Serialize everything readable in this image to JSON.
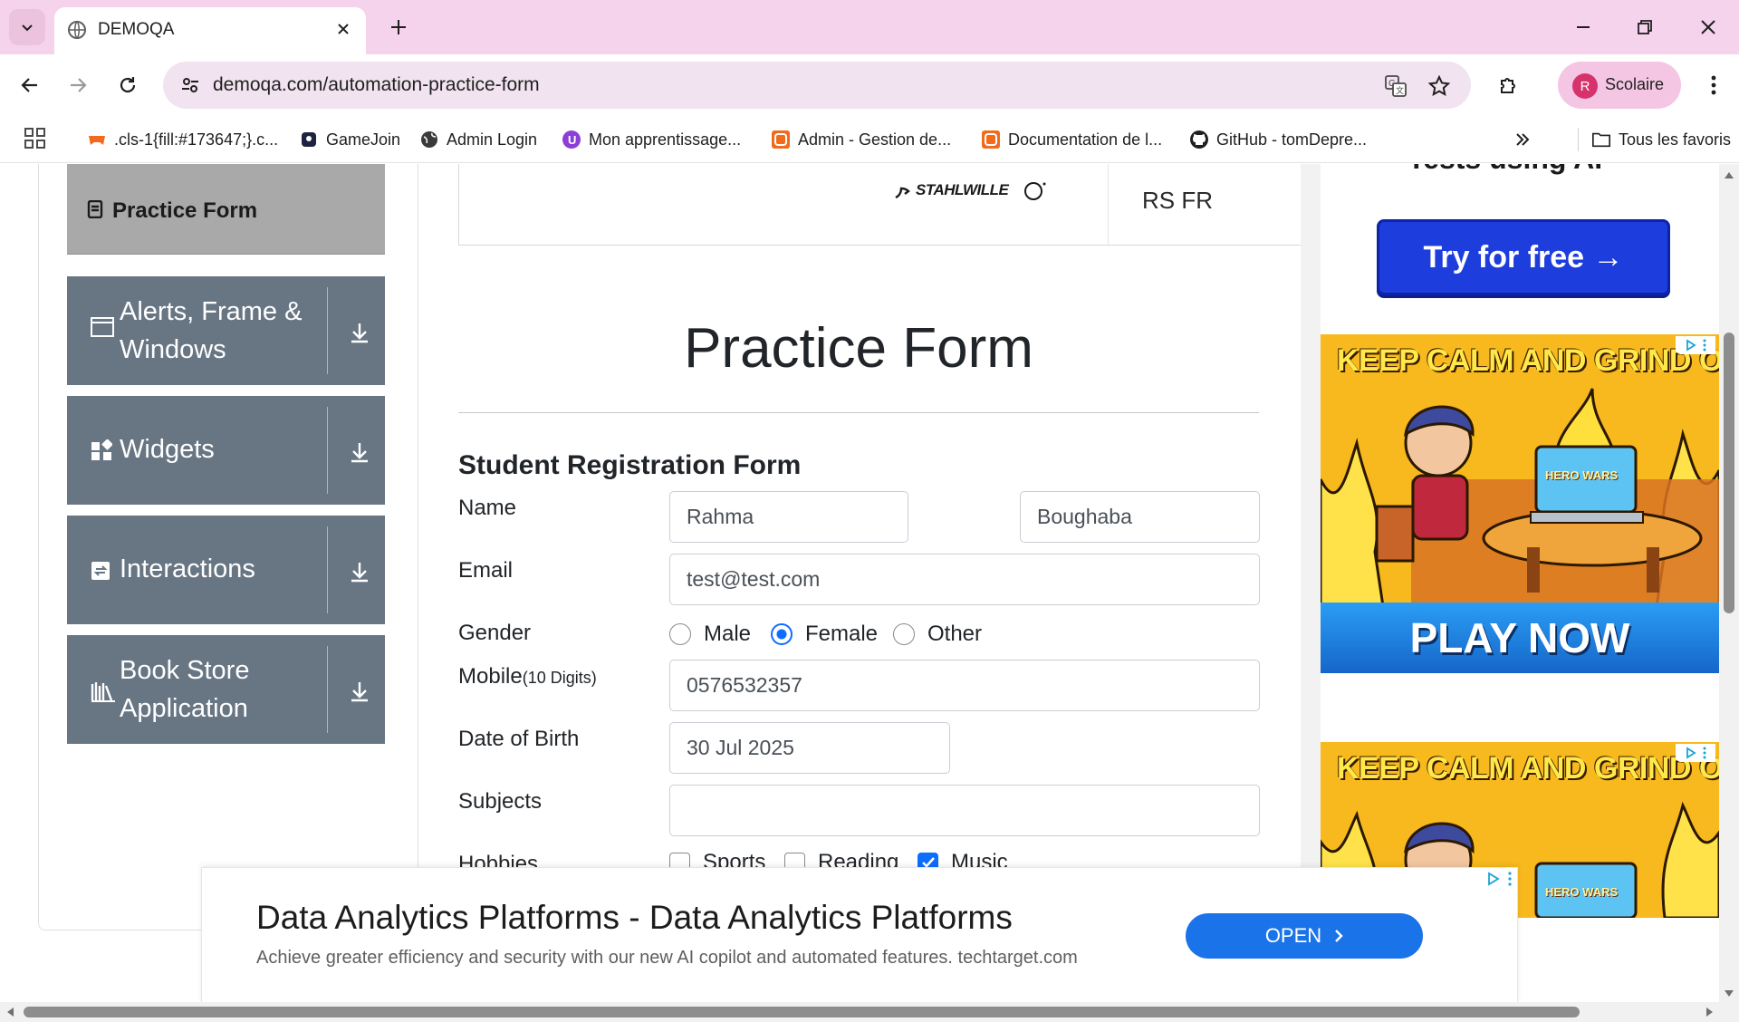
{
  "browser": {
    "tab_title": "DEMOQA",
    "url": "demoqa.com/automation-practice-form",
    "profile_initial": "R",
    "profile_name": "Scolaire",
    "bookmarks": [
      {
        "label": ".cls-1{fill:#173647;}.c...",
        "icon": "orange-controller-icon"
      },
      {
        "label": "GameJoin",
        "icon": "gamejoin-icon"
      },
      {
        "label": "Admin Login",
        "icon": "globe-icon"
      },
      {
        "label": "Mon apprentissage...",
        "icon": "purple-circle-icon"
      },
      {
        "label": "Admin - Gestion de...",
        "icon": "orange-grid-icon"
      },
      {
        "label": "Documentation de l...",
        "icon": "orange-grid-icon"
      },
      {
        "label": "GitHub - tomDepre...",
        "icon": "github-icon"
      }
    ],
    "all_bookmarks_label": "Tous les favoris"
  },
  "sidebar": {
    "active_item": "Practice Form",
    "groups": [
      {
        "label_line1": "Alerts, Frame &",
        "label_line2": "Windows",
        "icon": "window-icon"
      },
      {
        "label_line1": "Widgets",
        "label_line2": "",
        "icon": "widgets-icon"
      },
      {
        "label_line1": "Interactions",
        "label_line2": "",
        "icon": "interactions-icon"
      },
      {
        "label_line1": "Book Store",
        "label_line2": "Application",
        "icon": "books-icon"
      }
    ]
  },
  "banner_top": {
    "logo_text": "STAHLWILLE",
    "right_text": "RS FR"
  },
  "form": {
    "title": "Practice Form",
    "subtitle": "Student Registration Form",
    "name_label": "Name",
    "first_name": "Rahma",
    "last_name": "Boughaba",
    "email_label": "Email",
    "email": "test@test.com",
    "gender_label": "Gender",
    "gender_options": [
      "Male",
      "Female",
      "Other"
    ],
    "gender_selected": "Female",
    "mobile_label": "Mobile",
    "mobile_hint": "(10 Digits)",
    "mobile": "0576532357",
    "dob_label": "Date of Birth",
    "dob": "30 Jul 2025",
    "subjects_label": "Subjects",
    "subjects": "",
    "hobbies_label": "Hobbies",
    "hobbies": [
      {
        "label": "Sports",
        "checked": false
      },
      {
        "label": "Reading",
        "checked": false
      },
      {
        "label": "Music",
        "checked": true
      }
    ]
  },
  "ads": {
    "try_heading_cut": "Tests using AI",
    "try_button": "Try for free →",
    "hero_headline": "KEEP CALM AND GRIND ON",
    "hero_play": "PLAY NOW",
    "hero_brand": "HERO WARS",
    "bottom_title": "Data Analytics Platforms - Data Analytics Platforms",
    "bottom_desc": "Achieve greater efficiency and security with our new AI copilot and automated features. techtarget.com",
    "bottom_button": "OPEN"
  },
  "colors": {
    "tabbar_bg": "#f6d3ec",
    "sidebar_group_bg": "#687583",
    "sidebar_active_bg": "#a9a9a9",
    "accent_blue": "#0d6efd",
    "try_button_bg": "#1d3ddc",
    "open_button_bg": "#1a73e8"
  }
}
